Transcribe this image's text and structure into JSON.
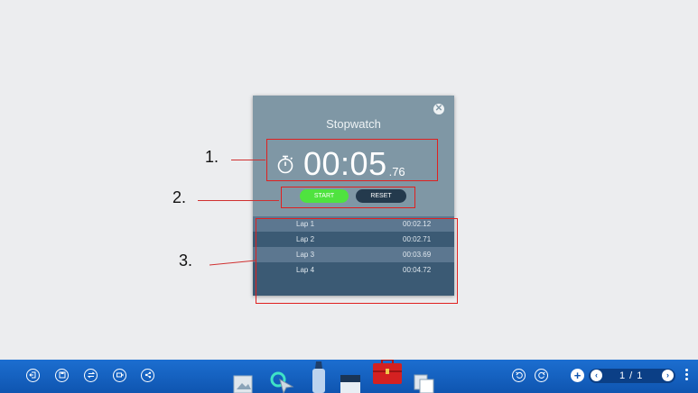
{
  "stopwatch": {
    "title": "Stopwatch",
    "close_glyph": "✕",
    "time_main": "00:05",
    "time_fraction": ".76",
    "start_label": "START",
    "reset_label": "RESET",
    "laps": [
      {
        "name": "Lap 1",
        "time": "00:02.12"
      },
      {
        "name": "Lap 2",
        "time": "00:02.71"
      },
      {
        "name": "Lap 3",
        "time": "00:03.69"
      },
      {
        "name": "Lap 4",
        "time": "00:04.72"
      }
    ],
    "colors": {
      "panel": "#7f97a5",
      "start": "#4fe33f",
      "reset": "#243a4d",
      "lap_dark": "#3b5a74",
      "lap_light": "#5c7790"
    },
    "icons": {
      "timer": "stopwatch-icon",
      "close": "close-icon"
    }
  },
  "annotations": {
    "label_1": "1.",
    "label_2": "2.",
    "label_3": "3.",
    "color": "#e0201f"
  },
  "toolbar": {
    "left_icons": [
      "exit-icon",
      "save-icon",
      "switch-icon",
      "record-icon",
      "share-icon"
    ],
    "center_tools": [
      "image-tool-icon",
      "select-tool-icon",
      "marker-tool-icon",
      "eraser-tool-icon",
      "toolbox-icon",
      "copy-tool-icon"
    ],
    "undo_icon": "undo-icon",
    "redo_icon": "redo-icon",
    "add_page_icon": "add-page-icon",
    "prev_glyph": "‹",
    "next_glyph": "›",
    "page_indicator": "1 / 1",
    "color": "#1563c2"
  }
}
